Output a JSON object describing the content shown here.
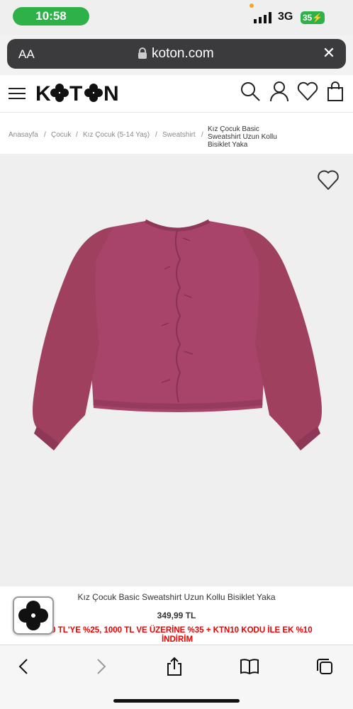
{
  "status": {
    "time": "10:58",
    "network": "3G",
    "battery": "35"
  },
  "browser": {
    "aa_label": "AA",
    "url": "koton.com"
  },
  "site": {
    "brand": "KOTON"
  },
  "breadcrumb": {
    "items": [
      "Anasayfa",
      "Çocuk",
      "Kız Çocuk (5-14 Yaş)",
      "Sweatshirt"
    ],
    "separator": "/",
    "current": "Kız Çocuk Basic Sweatshirt Uzun Kollu Bisiklet Yaka"
  },
  "product": {
    "title": "Kız Çocuk Basic Sweatshirt Uzun Kollu Bisiklet Yaka",
    "price": "349,99 TL",
    "promo": "500 TL'YE %25, 1000 TL VE ÜZERİNE %35 + KTN10 KODU İLE EK %10 İNDİRİM",
    "color": "#a8436a"
  },
  "colors": {
    "status_green": "#2fb14a",
    "promo_red": "#e00000"
  }
}
